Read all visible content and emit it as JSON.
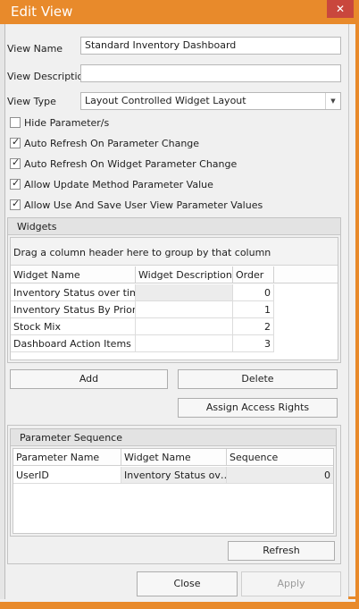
{
  "window": {
    "title": "Edit View",
    "close_glyph": "✕"
  },
  "fields": {
    "view_name_label": "View Name",
    "view_name_value": "Standard Inventory Dashboard",
    "view_description_label": "View Description",
    "view_description_value": "",
    "view_type_label": "View Type",
    "view_type_value": "Layout Controlled Widget Layout"
  },
  "options": [
    {
      "label": "Hide Parameter/s",
      "checked": false
    },
    {
      "label": "Auto Refresh On Parameter Change",
      "checked": true
    },
    {
      "label": "Auto Refresh On Widget Parameter Change",
      "checked": true
    },
    {
      "label": "Allow Update Method Parameter Value",
      "checked": true
    },
    {
      "label": "Allow Use And Save User View Parameter Values",
      "checked": true
    }
  ],
  "widgets": {
    "title": "Widgets",
    "group_hint": "Drag a column header here to group by that column",
    "columns": [
      "Widget Name",
      "Widget Description",
      "Order"
    ],
    "rows": [
      {
        "name": "Inventory Status over time",
        "description": "",
        "order": "0"
      },
      {
        "name": "Inventory Status By Priority",
        "description": "",
        "order": "1"
      },
      {
        "name": "Stock Mix",
        "description": "",
        "order": "2"
      },
      {
        "name": "Dashboard Action Items",
        "description": "",
        "order": "3"
      }
    ],
    "add_label": "Add",
    "delete_label": "Delete",
    "assign_label": "Assign Access Rights"
  },
  "parameter_sequence": {
    "title": "Parameter Sequence",
    "columns": [
      "Parameter Name",
      "Widget Name",
      "Sequence"
    ],
    "rows": [
      {
        "parameter": "UserID",
        "widget": "Inventory Status ov…",
        "sequence": "0"
      }
    ],
    "refresh_label": "Refresh"
  },
  "footer": {
    "close_label": "Close",
    "apply_label": "Apply"
  },
  "colors": {
    "accent": "#e88a2b",
    "close_button": "#c9473d"
  }
}
